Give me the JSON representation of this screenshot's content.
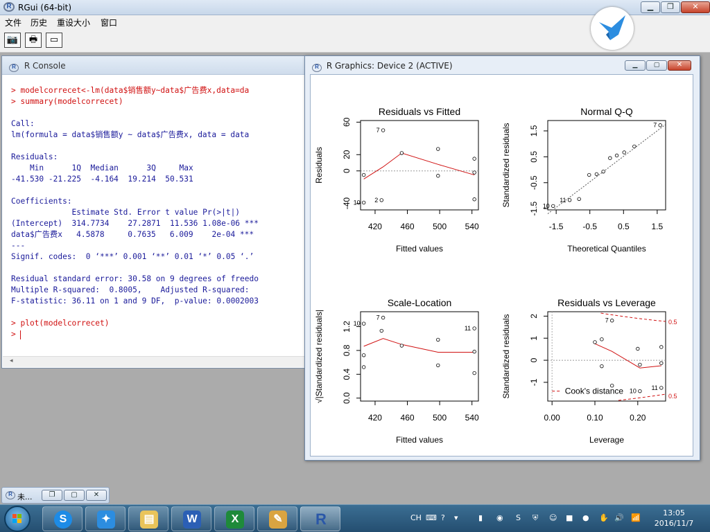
{
  "app": {
    "title": "RGui (64-bit)",
    "menu": [
      "文件",
      "历史",
      "重设大小",
      "窗口"
    ],
    "toolbar_icons": [
      "camera-icon",
      "print-icon",
      "console-icon"
    ]
  },
  "console": {
    "title": "R Console",
    "lines": [
      {
        "t": "> modelcorrecet<-lm(data$销售额y~data$广告费x,data=da",
        "c": "red"
      },
      {
        "t": "> summary(modelcorrecet)",
        "c": "red"
      },
      {
        "t": "",
        "c": ""
      },
      {
        "t": "Call:",
        "c": "blue"
      },
      {
        "t": "lm(formula = data$销售额y ~ data$广告费x, data = data",
        "c": "blue"
      },
      {
        "t": "",
        "c": ""
      },
      {
        "t": "Residuals:",
        "c": "blue"
      },
      {
        "t": "    Min      1Q  Median      3Q     Max",
        "c": "blue"
      },
      {
        "t": "-41.530 -21.225  -4.164  19.214  50.531",
        "c": "blue"
      },
      {
        "t": "",
        "c": ""
      },
      {
        "t": "Coefficients:",
        "c": "blue"
      },
      {
        "t": "             Estimate Std. Error t value Pr(>|t|)",
        "c": "blue"
      },
      {
        "t": "(Intercept)  314.7734    27.2871  11.536 1.08e-06 ***",
        "c": "blue"
      },
      {
        "t": "data$广告费x   4.5878     0.7635   6.009    2e-04 ***",
        "c": "blue"
      },
      {
        "t": "---",
        "c": "blue"
      },
      {
        "t": "Signif. codes:  0 ‘***’ 0.001 ‘**’ 0.01 ‘*’ 0.05 ‘.’",
        "c": "blue"
      },
      {
        "t": "",
        "c": ""
      },
      {
        "t": "Residual standard error: 30.58 on 9 degrees of freedo",
        "c": "blue"
      },
      {
        "t": "Multiple R-squared:  0.8005,    Adjusted R-squared:",
        "c": "blue"
      },
      {
        "t": "F-statistic: 36.11 on 1 and 9 DF,  p-value: 0.0002003",
        "c": "blue"
      },
      {
        "t": "",
        "c": ""
      },
      {
        "t": "> plot(modelcorrecet)",
        "c": "red"
      },
      {
        "t": "> ",
        "c": "red"
      }
    ]
  },
  "graphics": {
    "title": "R Graphics: Device 2 (ACTIVE)",
    "plots": [
      {
        "title": "Residuals vs Fitted",
        "xlabel": "Fitted values",
        "ylabel": "Residuals",
        "xticks": [
          "420",
          "460",
          "500",
          "540"
        ],
        "yticks": [
          "-40",
          "0",
          "20",
          "60"
        ],
        "xlim": [
          402,
          548
        ],
        "ylim": [
          -48,
          62
        ],
        "points": [
          [
            406,
            -5
          ],
          [
            406,
            -39
          ],
          [
            428,
            -36
          ],
          [
            430,
            50
          ],
          [
            453,
            22
          ],
          [
            498,
            27
          ],
          [
            498,
            -6
          ],
          [
            543,
            15
          ],
          [
            543,
            -2
          ],
          [
            543,
            -35
          ]
        ],
        "smooth": [
          [
            406,
            -10
          ],
          [
            430,
            5
          ],
          [
            453,
            22
          ],
          [
            498,
            8
          ],
          [
            543,
            -5
          ]
        ],
        "refline": 0,
        "labels": [
          {
            "t": "7",
            "x": 430,
            "y": 50
          },
          {
            "t": "2",
            "x": 428,
            "y": -36
          },
          {
            "t": "10",
            "x": 406,
            "y": -39
          }
        ]
      },
      {
        "title": "Normal Q-Q",
        "xlabel": "Theoretical Quantiles",
        "ylabel": "Standardized residuals",
        "xticks": [
          "-1.5",
          "-0.5",
          "0.5",
          "1.5"
        ],
        "yticks": [
          "-1.5",
          "-0.5",
          "0.5",
          "1.5"
        ],
        "xlim": [
          -1.75,
          1.75
        ],
        "ylim": [
          -1.55,
          1.9
        ],
        "points": [
          [
            -1.59,
            -1.4
          ],
          [
            -1.1,
            -1.17
          ],
          [
            -0.82,
            -1.13
          ],
          [
            -0.52,
            -0.2
          ],
          [
            -0.3,
            -0.17
          ],
          [
            -0.1,
            -0.07
          ],
          [
            0.1,
            0.45
          ],
          [
            0.3,
            0.55
          ],
          [
            0.52,
            0.67
          ],
          [
            0.82,
            0.9
          ],
          [
            1.59,
            1.72
          ]
        ],
        "refline_diag": [
          [
            -1.75,
            -1.7
          ],
          [
            1.75,
            1.75
          ]
        ],
        "labels": [
          {
            "t": "10",
            "x": -1.59,
            "y": -1.4
          },
          {
            "t": "11",
            "x": -1.1,
            "y": -1.17
          },
          {
            "t": "7",
            "x": 1.59,
            "y": 1.72
          }
        ]
      },
      {
        "title": "Scale-Location",
        "xlabel": "Fitted values",
        "ylabel": "√|Standardized residuals|",
        "xticks": [
          "420",
          "460",
          "500",
          "540"
        ],
        "yticks": [
          "0.0",
          "0.4",
          "0.8",
          "1.2"
        ],
        "xlim": [
          402,
          548
        ],
        "ylim": [
          -0.05,
          1.45
        ],
        "points": [
          [
            406,
            1.25
          ],
          [
            406,
            0.52
          ],
          [
            406,
            0.72
          ],
          [
            428,
            1.13
          ],
          [
            430,
            1.35
          ],
          [
            453,
            0.88
          ],
          [
            498,
            0.98
          ],
          [
            498,
            0.55
          ],
          [
            543,
            1.17
          ],
          [
            543,
            0.78
          ],
          [
            543,
            0.42
          ]
        ],
        "smooth": [
          [
            406,
            0.87
          ],
          [
            430,
            1.0
          ],
          [
            453,
            0.9
          ],
          [
            498,
            0.77
          ],
          [
            543,
            0.77
          ]
        ],
        "labels": [
          {
            "t": "10",
            "x": 406,
            "y": 1.25
          },
          {
            "t": "7",
            "x": 430,
            "y": 1.35
          },
          {
            "t": "11",
            "x": 543,
            "y": 1.17
          }
        ]
      },
      {
        "title": "Residuals vs Leverage",
        "xlabel": "Leverage",
        "ylabel": "Standardized residuals",
        "xticks": [
          "0.00",
          "0.10",
          "0.20"
        ],
        "yticks": [
          "-1",
          "0",
          "1",
          "2"
        ],
        "xlim": [
          -0.01,
          0.265
        ],
        "ylim": [
          -1.85,
          2.2
        ],
        "points": [
          [
            0.1,
            0.82
          ],
          [
            0.116,
            0.95
          ],
          [
            0.116,
            -0.27
          ],
          [
            0.14,
            1.8
          ],
          [
            0.14,
            -1.15
          ],
          [
            0.2,
            0.52
          ],
          [
            0.205,
            -0.2
          ],
          [
            0.205,
            -1.4
          ],
          [
            0.255,
            0.6
          ],
          [
            0.255,
            -0.13
          ],
          [
            0.255,
            -1.25
          ]
        ],
        "smooth": [
          [
            0.1,
            0.75
          ],
          [
            0.14,
            0.4
          ],
          [
            0.205,
            -0.35
          ],
          [
            0.255,
            -0.25
          ]
        ],
        "refline": 0,
        "labels": [
          {
            "t": "7",
            "x": 0.14,
            "y": 1.8
          },
          {
            "t": "10",
            "x": 0.205,
            "y": -1.4
          },
          {
            "t": "11",
            "x": 0.255,
            "y": -1.25
          }
        ],
        "legend": "Cook's distance",
        "cook_labels": [
          "0.5",
          "0.5"
        ]
      }
    ]
  },
  "minimized": {
    "title": "未..."
  },
  "taskbar": {
    "lang": "CH",
    "time": "13:05",
    "date": "2016/11/7"
  }
}
